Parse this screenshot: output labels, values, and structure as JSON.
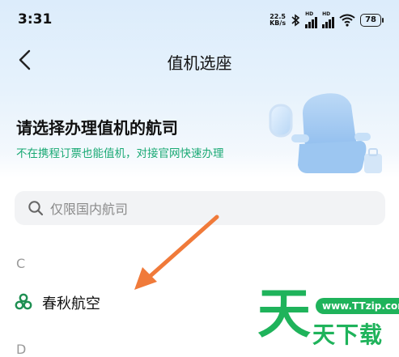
{
  "status_bar": {
    "time": "3:31",
    "net_speed_value": "22.5",
    "net_speed_unit": "KB/s",
    "hd_label": "HD",
    "battery": "78"
  },
  "nav": {
    "title": "值机选座",
    "back_icon": "chevron-left-icon"
  },
  "hero": {
    "title": "请选择办理值机的航司",
    "subtitle": "不在携程订票也能值机，对接官网快速办理",
    "illustration": "airplane-seat-illustration"
  },
  "search": {
    "placeholder": "仅限国内航司",
    "value": "",
    "icon": "search-icon"
  },
  "sections": [
    {
      "letter": "C",
      "airlines": [
        {
          "name": "春秋航空",
          "logo": "spring-airlines-logo"
        }
      ]
    },
    {
      "letter": "D",
      "airlines": []
    }
  ],
  "watermark": {
    "big_char": "天",
    "url": "www.TTzip.com",
    "small_text": "天下载"
  },
  "colors": {
    "accent_green": "#19a974",
    "arrow_orange": "#f07a3a",
    "watermark_green": "#1fb35b",
    "header_gradient_top": "#dcecfb"
  }
}
